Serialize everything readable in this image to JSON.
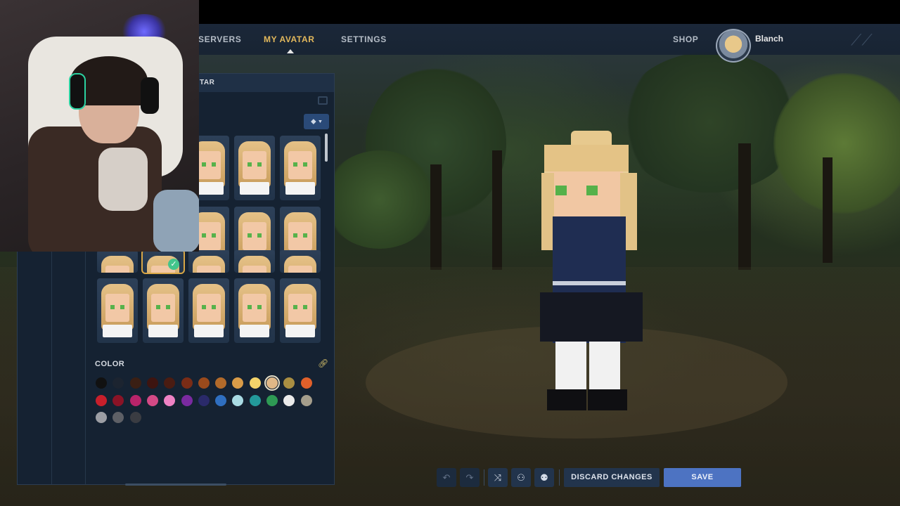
{
  "nav": {
    "servers": "SERVERS",
    "my_avatar": "MY AVATAR",
    "settings": "SETTINGS",
    "shop": "SHOP"
  },
  "profile": {
    "name": "Blanch"
  },
  "panel": {
    "title_fragment": "TAR",
    "color_label": "COLOR",
    "hair_tiles": [
      {
        "row": 0,
        "col": 2
      },
      {
        "row": 0,
        "col": 3
      },
      {
        "row": 0,
        "col": 4
      },
      {
        "row": 1,
        "col": 2
      },
      {
        "row": 1,
        "col": 3
      },
      {
        "row": 1,
        "col": 4
      },
      {
        "row": 2,
        "col": 0
      },
      {
        "row": 2,
        "col": 1,
        "selected": true
      },
      {
        "row": 2,
        "col": 2
      },
      {
        "row": 2,
        "col": 3
      },
      {
        "row": 2,
        "col": 4
      },
      {
        "row": 3,
        "col": 0
      },
      {
        "row": 3,
        "col": 1
      },
      {
        "row": 3,
        "col": 2
      },
      {
        "row": 3,
        "col": 3
      },
      {
        "row": 3,
        "col": 4
      }
    ],
    "colors": [
      "#111111",
      "#1c2430",
      "#3a1f14",
      "#3d1410",
      "#4a1c12",
      "#7a2c16",
      "#9a4a1c",
      "#b26a2a",
      "#d99c48",
      "#f3d46a",
      "#e1b887",
      "#a98e42",
      "#e0602a",
      "#c81f2b",
      "#8a1326",
      "#b8246a",
      "#d44a86",
      "#ee82c4",
      "#7a2aa0",
      "#2a2a6a",
      "#2f6fc0",
      "#a9dbe4",
      "#23999a",
      "#2e9a54",
      "#eaeaea",
      "#a59e8c",
      "#9c9ea4",
      "#5e6066",
      "#3a3c42"
    ],
    "selected_color": "#e1b887"
  },
  "toolbar": {
    "undo_icon": "undo-icon",
    "redo_icon": "redo-icon",
    "randomize_icon": "shuffle-icon",
    "discard_label": "DISCARD CHANGES",
    "save_label": "SAVE"
  }
}
